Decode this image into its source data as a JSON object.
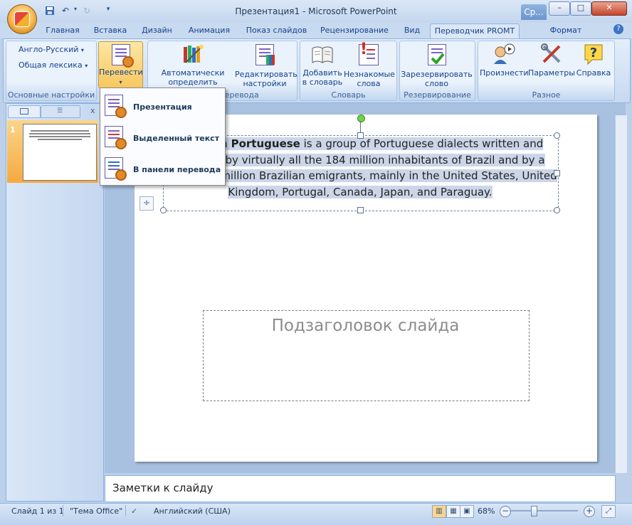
{
  "window": {
    "title": "Презентация1 - Microsoft PowerPoint",
    "context_tab": "Ср...",
    "buttons": {
      "minimize": "–",
      "maximize": "□",
      "close": "✕"
    }
  },
  "tabs": [
    {
      "label": "Главная"
    },
    {
      "label": "Вставка"
    },
    {
      "label": "Дизайн"
    },
    {
      "label": "Анимация"
    },
    {
      "label": "Показ слайдов"
    },
    {
      "label": "Рецензирование"
    },
    {
      "label": "Вид"
    },
    {
      "label": "Переводчик PROMT"
    },
    {
      "label": "Формат"
    }
  ],
  "ribbon": {
    "basic": {
      "direction": "Англо-Русский",
      "dictionary": "Общая лексика",
      "group_label": "Основные настройки"
    },
    "translate_button": "Перевести",
    "auto_topic": "Автоматически определить тематику",
    "edit_settings": "Редактировать настройки",
    "translation_group_label": "...перевода",
    "add_to_dict": "Добавить в словарь",
    "unknown_words": "Незнакомые слова",
    "dict_group_label": "Словарь",
    "reserve_word": "Зарезервировать слово",
    "reserve_group_label": "Резервирование",
    "pronounce": "Произнести",
    "params": "Параметры",
    "help": "Справка",
    "misc_group_label": "Разное"
  },
  "dropdown": {
    "items": [
      {
        "label": "Презентация"
      },
      {
        "label": "Выделенный текст"
      },
      {
        "label": "В панели перевода"
      }
    ]
  },
  "left_pane": {
    "close": "x",
    "slide_number": "1"
  },
  "slide": {
    "title_bold": "n Portuguese",
    "title_line1": " is a group of Portuguese dialects written and",
    "title_line2": "by virtually all the 184 million inhabitants of Brazil and by a",
    "title_line3": "million Brazilian emigrants, mainly in the United States, United",
    "title_line4": "Kingdom, Portugal, Canada, Japan, and Paraguay.",
    "subtitle_placeholder": "Подзаголовок слайда"
  },
  "notes": {
    "placeholder": "Заметки к слайду"
  },
  "status": {
    "slide": "Слайд 1 из 1",
    "theme": "\"Тема Office\"",
    "language": "Английский (США)",
    "zoom": "68%"
  }
}
